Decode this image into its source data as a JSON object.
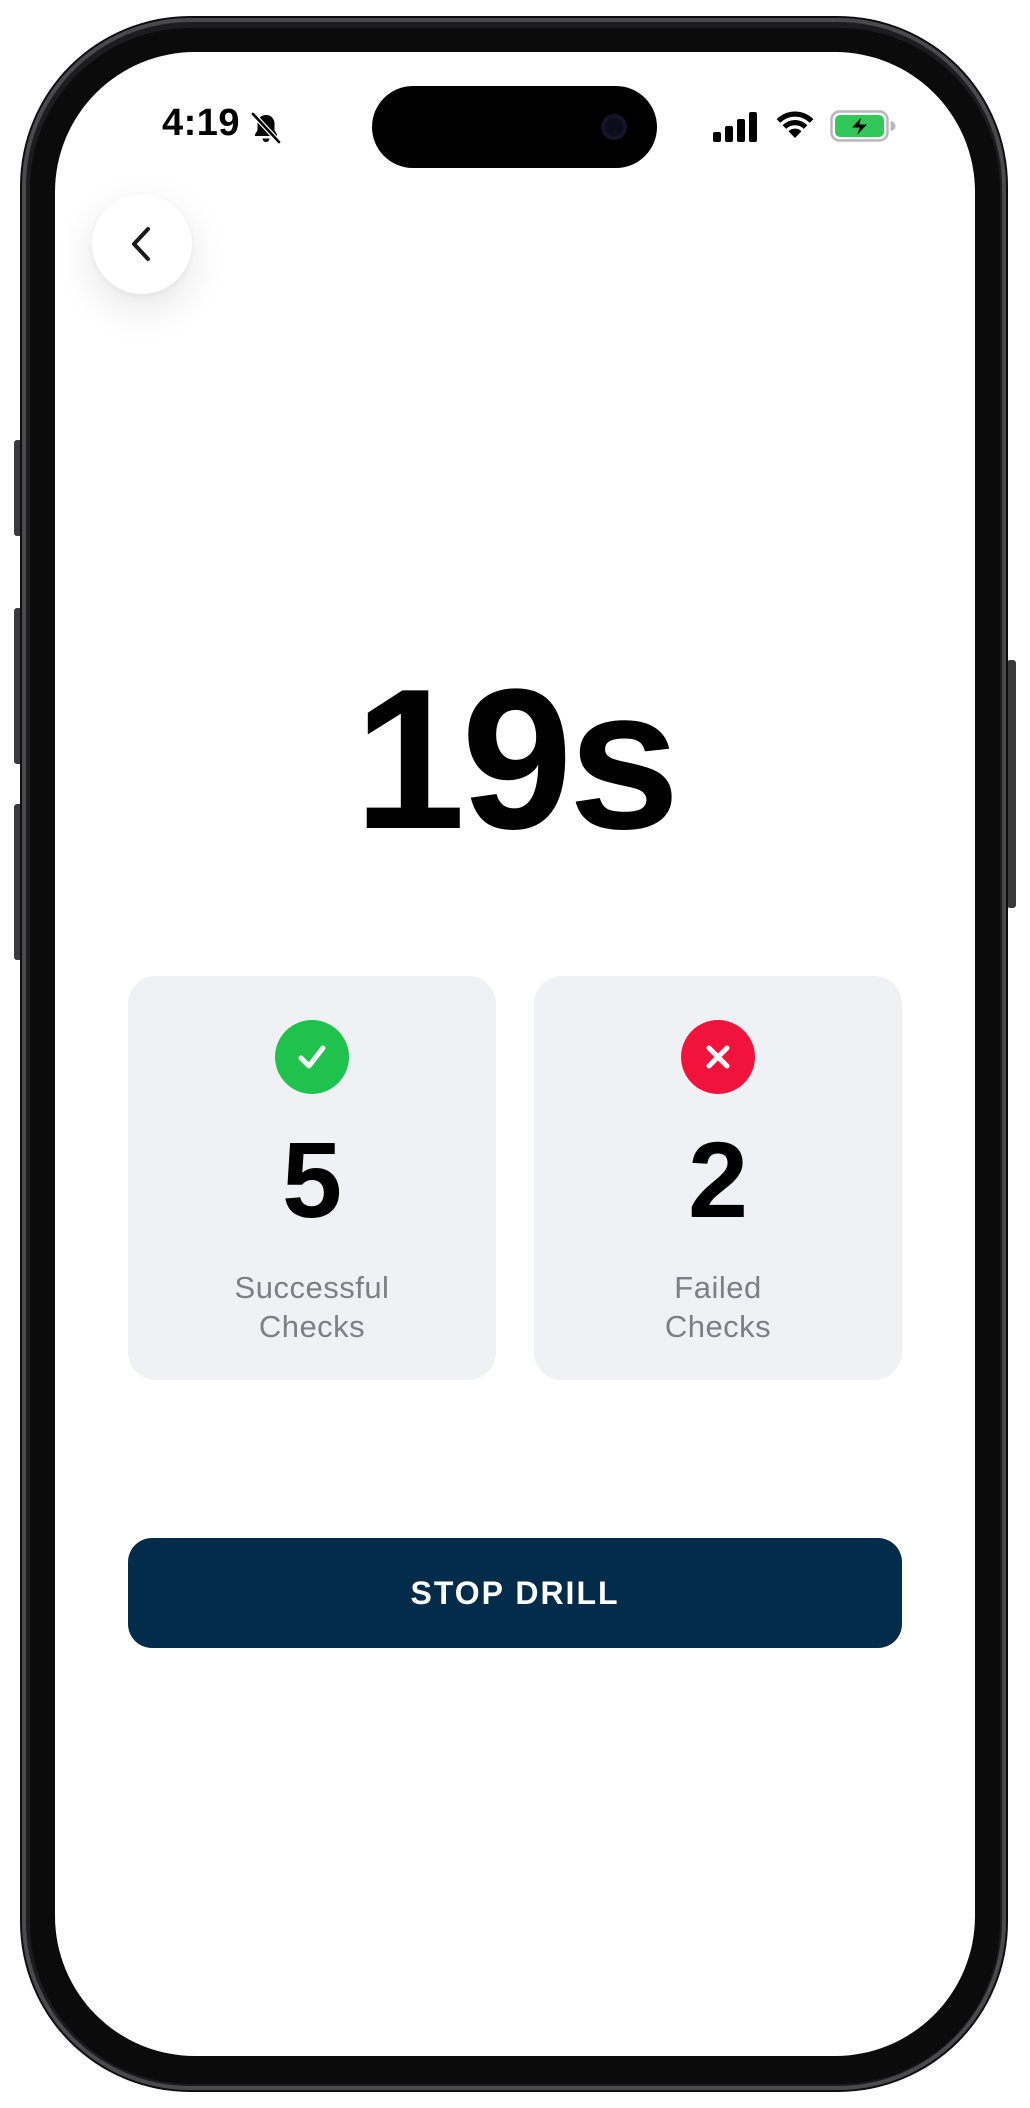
{
  "status_bar": {
    "time": "4:19",
    "silent_icon": "bell-slash-icon",
    "signal_icon": "cellular-signal-icon",
    "wifi_icon": "wifi-icon",
    "battery_icon": "battery-charging-icon",
    "battery_color": "#32c759"
  },
  "header": {
    "back_icon": "chevron-left-icon"
  },
  "timer": {
    "value": "19s"
  },
  "stats": {
    "success": {
      "icon": "checkmark-icon",
      "color": "#1ec24c",
      "count": "5",
      "label_line1": "Successful",
      "label_line2": "Checks"
    },
    "failed": {
      "icon": "x-mark-icon",
      "color": "#f2133d",
      "count": "2",
      "label_line1": "Failed",
      "label_line2": "Checks"
    }
  },
  "actions": {
    "stop_label": "STOP DRILL",
    "stop_color": "#022c4a"
  }
}
